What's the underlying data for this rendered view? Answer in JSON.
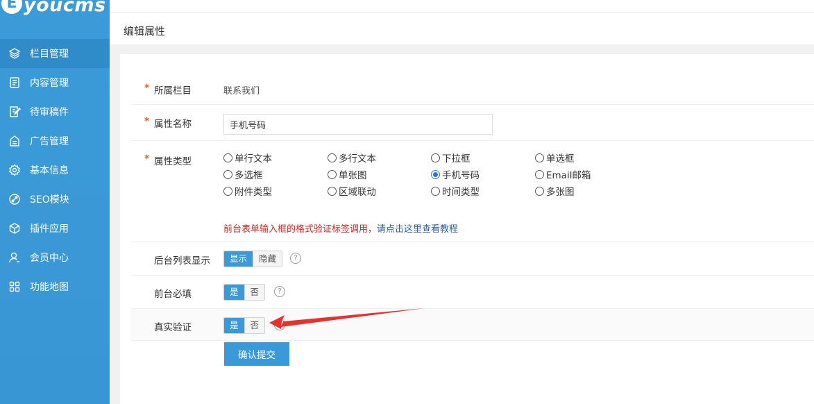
{
  "logo": {
    "mark": "E",
    "text": "youcms"
  },
  "sidebar": {
    "items": [
      {
        "label": "栏目管理",
        "icon": "layers-icon",
        "active": true
      },
      {
        "label": "内容管理",
        "icon": "document-icon"
      },
      {
        "label": "待审稿件",
        "icon": "edit-document-icon"
      },
      {
        "label": "广告管理",
        "icon": "ad-icon"
      },
      {
        "label": "基本信息",
        "icon": "gear-icon"
      },
      {
        "label": "SEO模块",
        "icon": "seo-icon"
      },
      {
        "label": "插件应用",
        "icon": "cube-icon"
      },
      {
        "label": "会员中心",
        "icon": "user-icon"
      },
      {
        "label": "功能地图",
        "icon": "grid-icon"
      }
    ]
  },
  "page": {
    "title": "编辑属性"
  },
  "form": {
    "required_mark": "*",
    "category": {
      "label": "所属栏目",
      "value": "联系我们"
    },
    "attr_name": {
      "label": "属性名称",
      "value": "手机号码"
    },
    "attr_type": {
      "label": "属性类型",
      "options": [
        "单行文本",
        "多行文本",
        "下拉框",
        "单选框",
        "多选框",
        "单张图",
        "手机号码",
        "Email邮箱",
        "附件类型",
        "区域联动",
        "时间类型",
        "多张图"
      ],
      "selected": "手机号码"
    },
    "hint": {
      "red": "前台表单输入框的格式验证标签调用，",
      "link": "请点击这里查看教程"
    },
    "list_display": {
      "label": "后台列表显示",
      "on": "显示",
      "off": "隐藏",
      "value": "显示"
    },
    "frontend_required": {
      "label": "前台必填",
      "on": "是",
      "off": "否",
      "value": "是"
    },
    "real_verify": {
      "label": "真实验证",
      "on": "是",
      "off": "否",
      "value": "是"
    },
    "help": "?",
    "submit": "确认提交"
  },
  "colors": {
    "sidebar": "#3a9ad9",
    "sidebar_active": "#2f8cc9",
    "required": "#e8631a",
    "hint_red": "#e02020",
    "arrow": "#e8302f"
  }
}
